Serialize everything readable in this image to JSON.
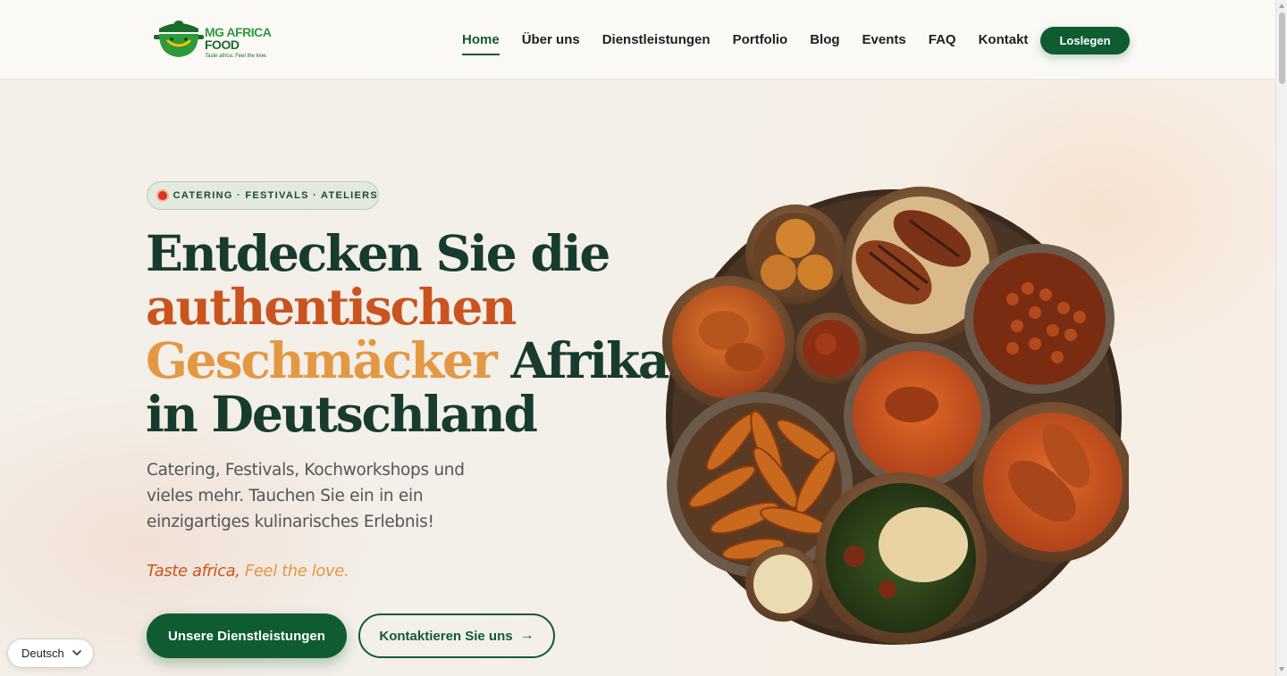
{
  "brand": {
    "name_line1": "MG AFRICA",
    "name_line2": "FOOD",
    "tagline": "Taste africa. Feel the love."
  },
  "nav": {
    "items": [
      "Home",
      "Über uns",
      "Dienstleistungen",
      "Portfolio",
      "Blog",
      "Events",
      "FAQ",
      "Kontakt"
    ],
    "active": "Home",
    "cta": "Loslegen"
  },
  "hero": {
    "badge": "CATERING · FESTIVALS · ATELIERS",
    "headline": {
      "line1": "Entdecken Sie die",
      "line2": "authentischen",
      "line3_a": "Geschmäcker",
      "line3_b": " Afrikas",
      "line4": "in Deutschland"
    },
    "subtext": "Catering, Festivals, Kochworkshops und vieles mehr. Tauchen Sie ein in ein einzigartiges kulinarisches Erlebnis!",
    "tagline_a": "Taste africa,",
    "tagline_b": " Feel the love.",
    "primary_button": "Unsere Dienstleistungen",
    "secondary_button": "Kontaktieren Sie uns",
    "secondary_icon": "arrow-right-icon"
  },
  "language": {
    "selected": "Deutsch"
  },
  "colors": {
    "brand_green": "#0f5c33",
    "headline_dark": "#173c2b",
    "accent_orange": "#c9541f",
    "accent_gold": "#e39844"
  }
}
